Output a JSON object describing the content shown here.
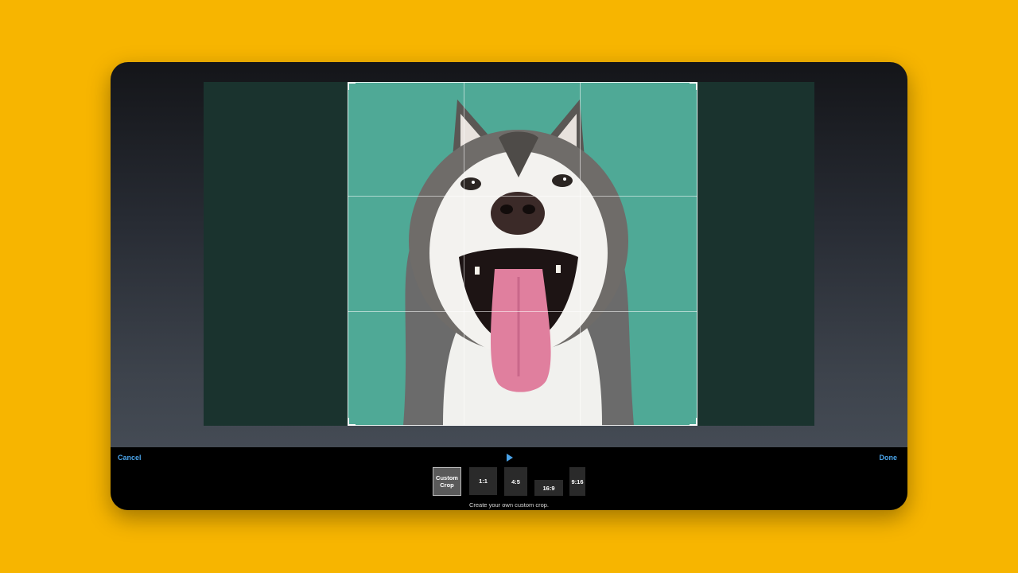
{
  "toolbar": {
    "cancel_label": "Cancel",
    "done_label": "Done",
    "play_icon": "play-icon",
    "hint_text": "Create your own custom crop."
  },
  "aspect_options": [
    {
      "label": "Custom Crop",
      "selected": true
    },
    {
      "label": "1:1",
      "selected": false
    },
    {
      "label": "4:5",
      "selected": false
    },
    {
      "label": "16:9",
      "selected": false
    },
    {
      "label": "9:16",
      "selected": false
    }
  ],
  "colors": {
    "background": "#F7B500",
    "accent": "#4aa3e8",
    "photo_backdrop": "#4fa996",
    "stage_dim": "#1a332e"
  },
  "icons": [
    "play-icon",
    "husky-photo"
  ]
}
